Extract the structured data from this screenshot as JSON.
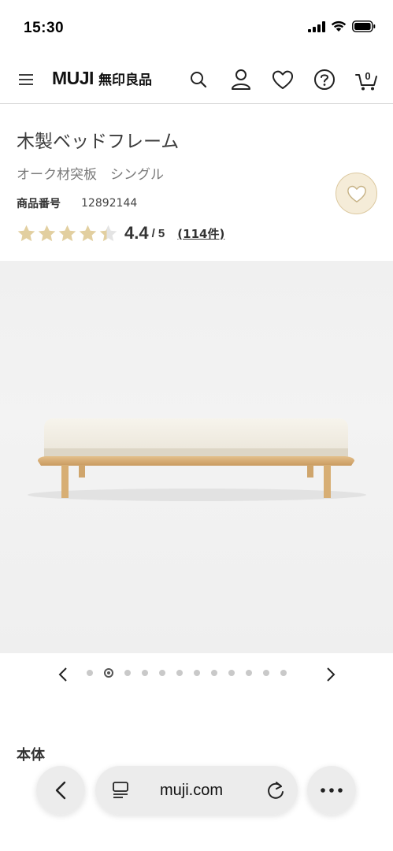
{
  "status_bar": {
    "time": "15:30"
  },
  "header": {
    "logo_en": "MUJI",
    "logo_jp": "無印良品",
    "cart_count": "0",
    "icons": [
      "menu-icon",
      "search-icon",
      "account-icon",
      "heart-icon",
      "help-icon",
      "cart-icon"
    ]
  },
  "product": {
    "title": "木製ベッドフレーム",
    "variant": "オーク材突板　シングル",
    "code_label": "商品番号",
    "code_value": "12892144",
    "rating_value": "4.4",
    "rating_max": "/ 5",
    "rating_stars": 4.4,
    "review_count": "(114件)"
  },
  "gallery": {
    "total": 12,
    "active_index": 1
  },
  "section": {
    "title": "本体"
  },
  "browser": {
    "url": "muji.com"
  },
  "colors": {
    "star": "#e2cfa0",
    "star_empty": "#e4e4e4",
    "fav_bg": "#f5ecd8",
    "divider": "#d8d8d8"
  }
}
